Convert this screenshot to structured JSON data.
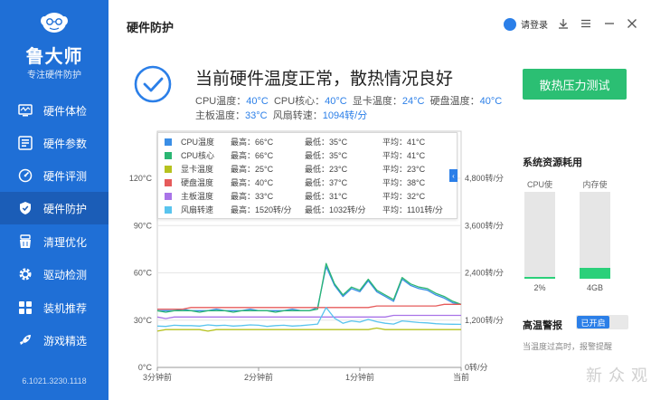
{
  "sidebar": {
    "app_name": "鲁大师",
    "app_subtitle": "专注硬件防护",
    "version": "6.1021.3230.1118",
    "items": [
      {
        "label": "硬件体检",
        "icon": "monitor-check-icon",
        "active": false
      },
      {
        "label": "硬件参数",
        "icon": "parameters-list-icon",
        "active": false
      },
      {
        "label": "硬件评测",
        "icon": "speedometer-icon",
        "active": false
      },
      {
        "label": "硬件防护",
        "icon": "shield-icon",
        "active": true
      },
      {
        "label": "清理优化",
        "icon": "broom-icon",
        "active": false
      },
      {
        "label": "驱动检测",
        "icon": "gear-icon",
        "active": false
      },
      {
        "label": "装机推荐",
        "icon": "puzzle-icon",
        "active": false
      },
      {
        "label": "游戏精选",
        "icon": "rocket-icon",
        "active": false
      }
    ]
  },
  "header": {
    "title": "硬件防护",
    "login_label": "请登录"
  },
  "status": {
    "title": "当前硬件温度正常，散热情况良好",
    "line1": [
      {
        "label": "CPU温度：",
        "value": "40°C"
      },
      {
        "label": "CPU核心：",
        "value": "40°C"
      },
      {
        "label": "显卡温度：",
        "value": "24°C"
      },
      {
        "label": "硬盘温度：",
        "value": "40°C"
      }
    ],
    "line2": [
      {
        "label": "主板温度：",
        "value": "33°C"
      },
      {
        "label": "风扇转速：",
        "value": "1094转/分"
      }
    ],
    "stress_button": "散热压力测试"
  },
  "chart_data": {
    "type": "line",
    "x_ticks": [
      "3分钟前",
      "2分钟前",
      "1分钟前",
      "当前"
    ],
    "y_left_ticks": [
      "0°C",
      "30°C",
      "60°C",
      "90°C",
      "120°C"
    ],
    "y_right_ticks": [
      "0转/分",
      "1,200转/分",
      "2,400转/分",
      "3,600转/分",
      "4,800转/分"
    ],
    "ylim_left": [
      0,
      120
    ],
    "ylim_right": [
      0,
      4800
    ],
    "x": [
      0,
      5,
      10,
      15,
      20,
      25,
      30,
      35,
      40,
      45,
      50,
      55,
      60,
      65,
      70,
      75,
      80,
      85,
      90,
      95,
      100,
      105,
      110,
      115,
      120,
      125,
      130,
      135,
      140,
      145,
      150,
      155,
      160,
      165,
      170,
      175,
      180
    ],
    "series": [
      {
        "name": "CPU温度",
        "color": "#3a8ee6",
        "axis": "left",
        "values": [
          36,
          36,
          36,
          37,
          36,
          36,
          36,
          37,
          36,
          36,
          36,
          37,
          36,
          36,
          36,
          36,
          37,
          36,
          36,
          38,
          64,
          52,
          45,
          50,
          48,
          55,
          48,
          45,
          42,
          56,
          52,
          50,
          49,
          46,
          44,
          41,
          40
        ]
      },
      {
        "name": "CPU核心",
        "color": "#2bb673",
        "axis": "left",
        "values": [
          36,
          35,
          36,
          36,
          36,
          35,
          36,
          36,
          36,
          35,
          36,
          36,
          36,
          36,
          35,
          36,
          36,
          36,
          36,
          37,
          66,
          53,
          46,
          51,
          49,
          56,
          49,
          46,
          43,
          57,
          53,
          51,
          50,
          47,
          45,
          42,
          40
        ]
      },
      {
        "name": "显卡温度",
        "color": "#b6c21f",
        "axis": "left",
        "values": [
          23,
          24,
          24,
          24,
          24,
          24,
          23,
          24,
          24,
          24,
          24,
          24,
          24,
          24,
          24,
          24,
          24,
          24,
          24,
          24,
          24,
          24,
          24,
          24,
          24,
          24,
          25,
          24,
          24,
          24,
          24,
          24,
          24,
          24,
          24,
          24,
          24
        ]
      },
      {
        "name": "硬盘温度",
        "color": "#e65b5b",
        "axis": "left",
        "values": [
          37,
          37,
          37,
          37,
          38,
          38,
          38,
          38,
          38,
          38,
          38,
          38,
          38,
          38,
          38,
          38,
          38,
          38,
          38,
          38,
          38,
          38,
          38,
          38,
          38,
          38,
          39,
          39,
          39,
          39,
          39,
          39,
          39,
          39,
          40,
          40,
          40
        ]
      },
      {
        "name": "主板温度",
        "color": "#a974e8",
        "axis": "left",
        "values": [
          32,
          31,
          32,
          32,
          32,
          32,
          32,
          32,
          32,
          32,
          32,
          32,
          32,
          32,
          32,
          32,
          32,
          32,
          32,
          32,
          32,
          32,
          32,
          32,
          32,
          32,
          32,
          32,
          33,
          33,
          33,
          33,
          33,
          33,
          33,
          33,
          33
        ]
      },
      {
        "name": "风扇转速",
        "color": "#59c4ee",
        "axis": "right",
        "values": [
          1050,
          1040,
          1070,
          1060,
          1060,
          1050,
          1080,
          1060,
          1070,
          1050,
          1060,
          1080,
          1070,
          1040,
          1060,
          1070,
          1050,
          1060,
          1080,
          1100,
          1520,
          1250,
          1120,
          1180,
          1150,
          1220,
          1160,
          1120,
          1100,
          1180,
          1160,
          1140,
          1130,
          1110,
          1100,
          1095,
          1094
        ]
      }
    ],
    "legend": [
      {
        "name": "CPU温度",
        "color": "#3a8ee6",
        "max": "最高：66°C",
        "min": "最低：35°C",
        "avg": "平均：41°C"
      },
      {
        "name": "CPU核心",
        "color": "#2bb673",
        "max": "最高：66°C",
        "min": "最低：35°C",
        "avg": "平均：41°C"
      },
      {
        "name": "显卡温度",
        "color": "#b6c21f",
        "max": "最高：25°C",
        "min": "最低：23°C",
        "avg": "平均：23°C"
      },
      {
        "name": "硬盘温度",
        "color": "#e65b5b",
        "max": "最高：40°C",
        "min": "最低：37°C",
        "avg": "平均：38°C"
      },
      {
        "name": "主板温度",
        "color": "#a974e8",
        "max": "最高：33°C",
        "min": "最低：31°C",
        "avg": "平均：32°C"
      },
      {
        "name": "风扇转速",
        "color": "#59c4ee",
        "max": "最高：1520转/分",
        "min": "最低：1032转/分",
        "avg": "平均：1101转/分"
      }
    ],
    "grid": true
  },
  "resources": {
    "title": "系统资源耗用",
    "cpu_label": "CPU使用",
    "cpu_value": "2%",
    "cpu_fraction": 0.02,
    "mem_label": "内存使用",
    "mem_value": "4GB",
    "mem_fraction": 0.12,
    "fill_color": "#2bd07a"
  },
  "alarm": {
    "title": "高温警报",
    "toggle_label": "已开启",
    "description": "当温度过高时，报警提醒"
  },
  "watermark": "新 众 观",
  "colors": {
    "sidebar": "#1f6fd6",
    "accent": "#2b7fe8",
    "success": "#2bbf73"
  }
}
